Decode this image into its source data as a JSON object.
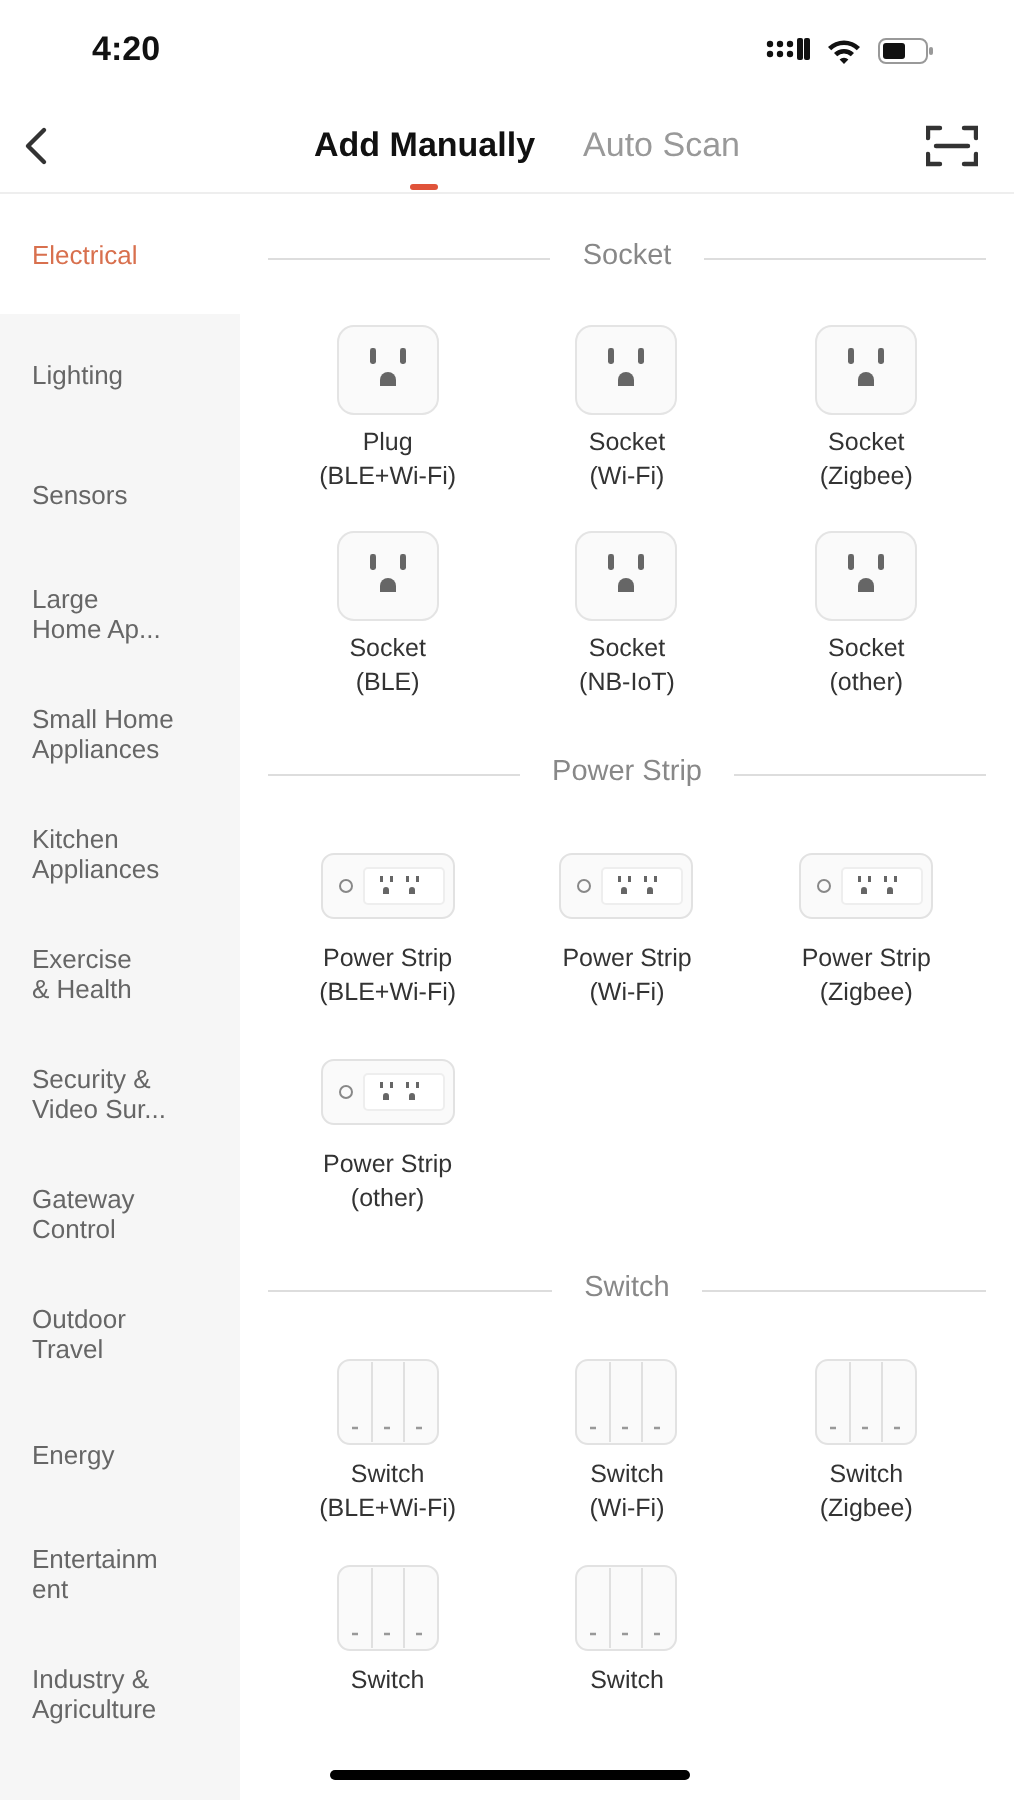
{
  "status_bar": {
    "time": "4:20"
  },
  "tabs": [
    {
      "label": "Add Manually",
      "selected": true
    },
    {
      "label": "Auto Scan",
      "selected": false
    }
  ],
  "sidebar": {
    "items": [
      {
        "lines": [
          "Electrical"
        ],
        "selected": true
      },
      {
        "lines": [
          "Lighting"
        ],
        "selected": false
      },
      {
        "lines": [
          "Sensors"
        ],
        "selected": false
      },
      {
        "lines": [
          "Large",
          "Home Ap..."
        ],
        "selected": false
      },
      {
        "lines": [
          "Small Home",
          "Appliances"
        ],
        "selected": false
      },
      {
        "lines": [
          "Kitchen",
          "Appliances"
        ],
        "selected": false
      },
      {
        "lines": [
          "Exercise",
          "& Health"
        ],
        "selected": false
      },
      {
        "lines": [
          "Security &",
          "Video Sur..."
        ],
        "selected": false
      },
      {
        "lines": [
          "Gateway",
          "Control"
        ],
        "selected": false
      },
      {
        "lines": [
          "Outdoor",
          "Travel"
        ],
        "selected": false
      },
      {
        "lines": [
          "Energy"
        ],
        "selected": false
      },
      {
        "lines": [
          "Entertainm",
          "ent"
        ],
        "selected": false
      },
      {
        "lines": [
          "Industry &",
          "Agriculture"
        ],
        "selected": false
      }
    ]
  },
  "sections": [
    {
      "title": "Socket",
      "items": [
        {
          "kind": "socket",
          "lines": [
            "Plug",
            "(BLE+Wi-Fi)"
          ]
        },
        {
          "kind": "socket",
          "lines": [
            "Socket",
            "(Wi-Fi)"
          ]
        },
        {
          "kind": "socket",
          "lines": [
            "Socket",
            "(Zigbee)"
          ]
        },
        {
          "kind": "socket",
          "lines": [
            "Socket",
            "(BLE)"
          ]
        },
        {
          "kind": "socket",
          "lines": [
            "Socket",
            "(NB-IoT)"
          ]
        },
        {
          "kind": "socket",
          "lines": [
            "Socket",
            "(other)"
          ]
        }
      ]
    },
    {
      "title": "Power Strip",
      "items": [
        {
          "kind": "strip",
          "lines": [
            "Power Strip",
            "(BLE+Wi-Fi)"
          ]
        },
        {
          "kind": "strip",
          "lines": [
            "Power Strip",
            "(Wi-Fi)"
          ]
        },
        {
          "kind": "strip",
          "lines": [
            "Power Strip",
            "(Zigbee)"
          ]
        },
        {
          "kind": "strip",
          "lines": [
            "Power Strip",
            "(other)"
          ]
        }
      ]
    },
    {
      "title": "Switch",
      "items": [
        {
          "kind": "switch",
          "lines": [
            "Switch",
            "(BLE+Wi-Fi)"
          ]
        },
        {
          "kind": "switch",
          "lines": [
            "Switch",
            "(Wi-Fi)"
          ]
        },
        {
          "kind": "switch",
          "lines": [
            "Switch",
            "(Zigbee)"
          ]
        },
        {
          "kind": "switch",
          "lines": [
            "Switch"
          ]
        },
        {
          "kind": "switch",
          "lines": [
            "Switch"
          ]
        }
      ]
    }
  ]
}
